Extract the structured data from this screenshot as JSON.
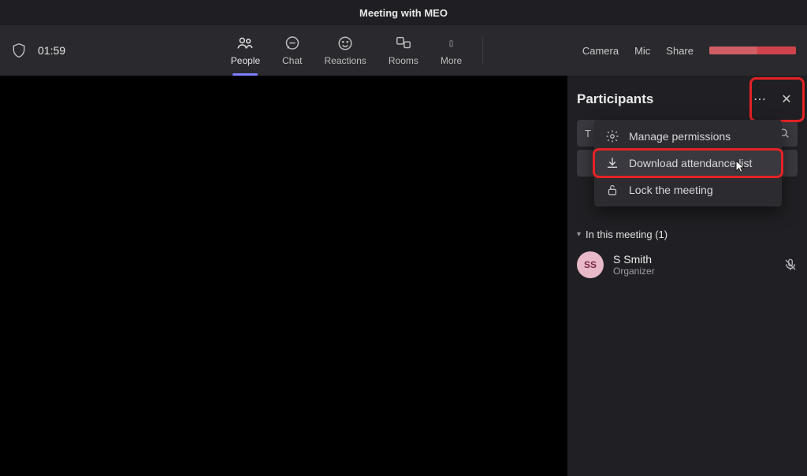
{
  "meeting_title": "Meeting with MEO",
  "timer": "01:59",
  "tabs": {
    "people": "People",
    "chat": "Chat",
    "reactions": "Reactions",
    "rooms": "Rooms",
    "more": "More"
  },
  "controls": {
    "camera": "Camera",
    "mic": "Mic",
    "share": "Share"
  },
  "panel": {
    "title": "Participants",
    "search_label": "T",
    "menu": {
      "manage": "Manage permissions",
      "download": "Download attendance list",
      "lock": "Lock the meeting"
    },
    "section_label": "In this meeting (1)",
    "participant": {
      "initials": "SS",
      "name": "S Smith",
      "role": "Organizer"
    }
  }
}
